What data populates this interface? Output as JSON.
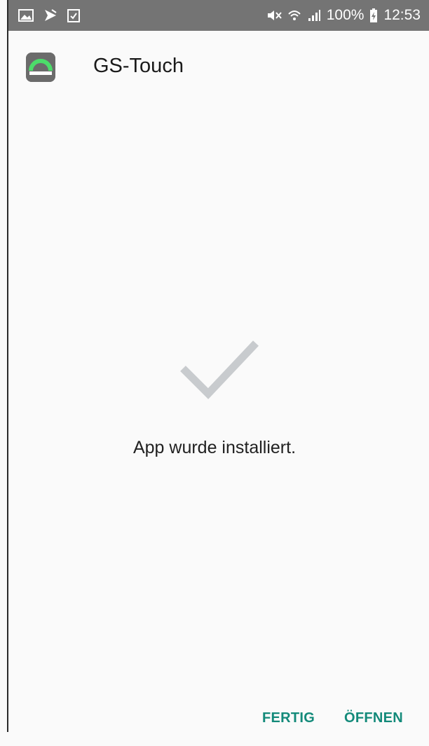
{
  "status_bar": {
    "battery": "100%",
    "time": "12:53",
    "left_icons": [
      "gallery-icon",
      "play-store-icon",
      "checklist-icon"
    ],
    "right_icons": [
      "mute-icon",
      "wifi-icon",
      "signal-icon",
      "battery-charging-icon"
    ]
  },
  "app": {
    "name": "GS-Touch",
    "icon": "gs-touch-app-icon"
  },
  "result": {
    "icon": "checkmark-icon",
    "message": "App wurde installiert."
  },
  "actions": {
    "done_label": "FERTIG",
    "open_label": "ÖFFNEN"
  },
  "colors": {
    "accent": "#138a7a",
    "status_bar_bg": "#747474",
    "background": "#fafafa",
    "checkmark": "#c8cbce",
    "app_icon_arc": "#4cdc6a"
  }
}
